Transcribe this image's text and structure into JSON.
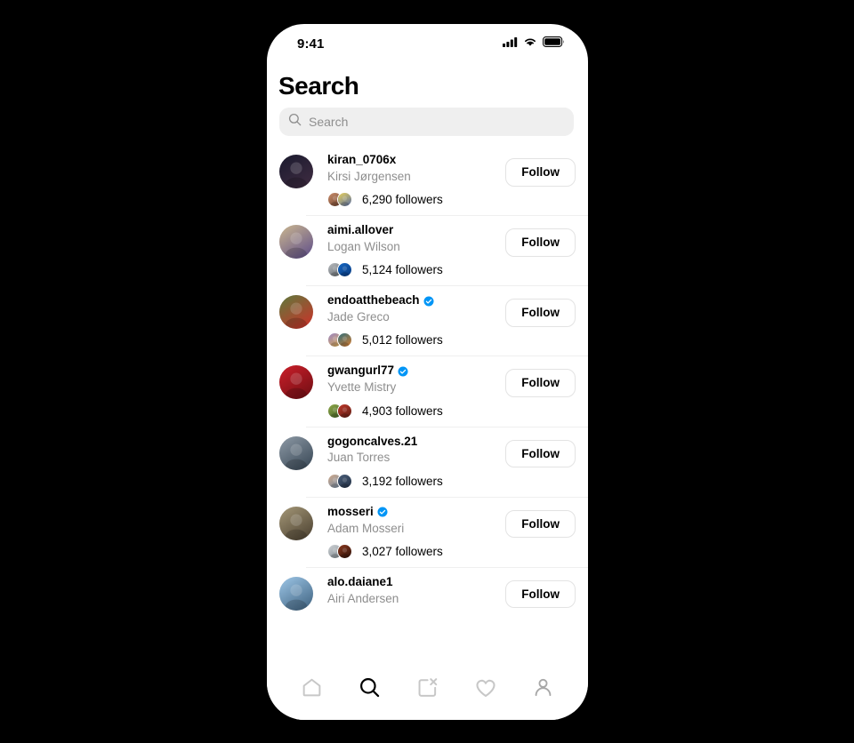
{
  "status_bar": {
    "time": "9:41",
    "icons": [
      "cellular-signal-icon",
      "wifi-icon",
      "battery-icon"
    ]
  },
  "header": {
    "title": "Search"
  },
  "search": {
    "placeholder": "Search",
    "value": "",
    "icon": "search-icon"
  },
  "colors": {
    "verified_blue": "#0095f6",
    "search_bg": "#efefef",
    "secondary_text": "#8e8e8e",
    "divider": "#efefef",
    "frame": "#000000"
  },
  "results": [
    {
      "username": "kiran_0706x",
      "fullname": "Kirsi Jørgensen",
      "verified": false,
      "followers": "6,290 followers",
      "follow_label": "Follow",
      "avatar_colors": [
        "#1a1a2e",
        "#3b2a3f"
      ],
      "mini_colors": [
        [
          "#c98f6e",
          "#7a4a32"
        ],
        [
          "#e8d15c",
          "#6b7a9a"
        ]
      ]
    },
    {
      "username": "aimi.allover",
      "fullname": "Logan Wilson",
      "verified": false,
      "followers": "5,124 followers",
      "follow_label": "Follow",
      "avatar_colors": [
        "#cbb78f",
        "#6b5a8a"
      ],
      "mini_colors": [
        [
          "#b9bcc0",
          "#6e7478"
        ],
        [
          "#1668c4",
          "#0a3f87"
        ]
      ]
    },
    {
      "username": "endoatthebeach",
      "fullname": "Jade Greco",
      "verified": true,
      "followers": "5,012 followers",
      "follow_label": "Follow",
      "avatar_colors": [
        "#5d7a3c",
        "#c0392b"
      ],
      "mini_colors": [
        [
          "#9b86c4",
          "#d2a55c"
        ],
        [
          "#2f6f7a",
          "#c07a3a"
        ]
      ]
    },
    {
      "username": "gwangurl77",
      "fullname": "Yvette Mistry",
      "verified": true,
      "followers": "4,903 followers",
      "follow_label": "Follow",
      "avatar_colors": [
        "#cc1f2a",
        "#7a1016"
      ],
      "mini_colors": [
        [
          "#8fa84a",
          "#4e6b2a"
        ],
        [
          "#c0392b",
          "#6b2016"
        ]
      ]
    },
    {
      "username": "gogoncalves.21",
      "fullname": "Juan Torres",
      "verified": false,
      "followers": "3,192 followers",
      "follow_label": "Follow",
      "avatar_colors": [
        "#8e9aa6",
        "#41505e"
      ],
      "mini_colors": [
        [
          "#cfa98b",
          "#7d8c9e"
        ],
        [
          "#4a5f7a",
          "#27354a"
        ]
      ]
    },
    {
      "username": "mosseri",
      "fullname": "Adam Mosseri",
      "verified": true,
      "followers": "3,027 followers",
      "follow_label": "Follow",
      "avatar_colors": [
        "#a59878",
        "#554a38"
      ],
      "mini_colors": [
        [
          "#cfd3d6",
          "#8a9298"
        ],
        [
          "#8c3a1f",
          "#3a160c"
        ]
      ]
    },
    {
      "username": "alo.daiane1",
      "fullname": "Airi Andersen",
      "verified": false,
      "followers": "",
      "follow_label": "Follow",
      "avatar_colors": [
        "#9ec7e8",
        "#4a6e8c"
      ],
      "mini_colors": [
        [
          "#cccccc",
          "#999999"
        ],
        [
          "#cccccc",
          "#999999"
        ]
      ]
    }
  ],
  "tab_bar": {
    "items": [
      {
        "name": "home-icon",
        "label": "Home",
        "active": false
      },
      {
        "name": "search-icon",
        "label": "Search",
        "active": true
      },
      {
        "name": "create-icon",
        "label": "Create",
        "active": false
      },
      {
        "name": "heart-icon",
        "label": "Activity",
        "active": false
      },
      {
        "name": "profile-icon",
        "label": "Profile",
        "active": false
      }
    ]
  }
}
